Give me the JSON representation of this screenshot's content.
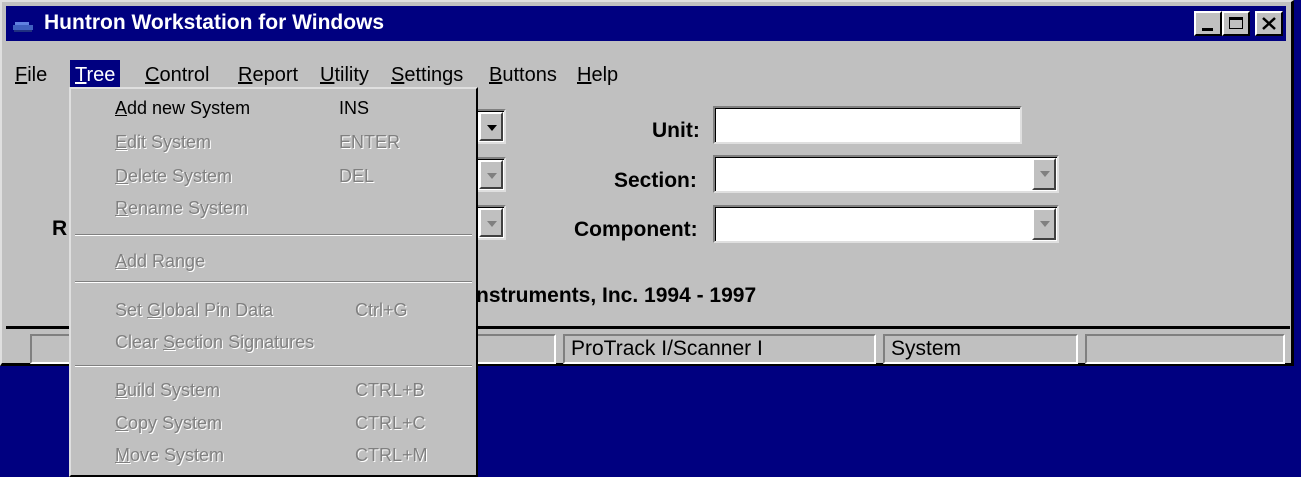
{
  "window": {
    "title": "Huntron Workstation for Windows"
  },
  "menubar": {
    "items": [
      {
        "label": "File",
        "mn": "F",
        "rest": "ile"
      },
      {
        "label": "Tree",
        "mn": "T",
        "rest": "ree"
      },
      {
        "label": "Control",
        "mn": "C",
        "rest": "ontrol"
      },
      {
        "label": "Report",
        "mn": "R",
        "rest": "eport"
      },
      {
        "label": "Utility",
        "mn": "U",
        "rest": "tility"
      },
      {
        "label": "Settings",
        "mn": "S",
        "rest": "ettings"
      },
      {
        "label": "Buttons",
        "mn": "B",
        "rest": "uttons"
      },
      {
        "label": "Help",
        "mn": "H",
        "rest": "elp"
      }
    ]
  },
  "form": {
    "unit_label": "Unit:",
    "unit_value": "",
    "section_label": "Section:",
    "section_value": "",
    "component_label": "Component:",
    "component_value": "",
    "hidden_label_fragment": "R",
    "copyright_fragment": "nstruments, Inc. 1994 - 1997"
  },
  "status_bar": {
    "panels": [
      "",
      "",
      "ProTrack I/Scanner I",
      "System",
      ""
    ]
  },
  "tree_menu": {
    "items": [
      {
        "mn": "A",
        "rest": "dd new System",
        "shortcut": "INS",
        "enabled": true
      },
      {
        "mn": "E",
        "rest": "dit System",
        "shortcut": "ENTER",
        "enabled": false
      },
      {
        "mn": "D",
        "rest": "elete System",
        "shortcut": "DEL",
        "enabled": false
      },
      {
        "mn": "R",
        "rest": "ename System",
        "shortcut": "",
        "enabled": false
      },
      {
        "mn": "A",
        "rest": "dd Range",
        "shortcut": "",
        "enabled": false
      },
      {
        "pre": "Set ",
        "mn": "G",
        "rest": "lobal Pin Data",
        "shortcut": "Ctrl+G",
        "enabled": false
      },
      {
        "pre": "Clear ",
        "mn": "S",
        "rest": "ection Signatures",
        "shortcut": "",
        "enabled": false
      },
      {
        "mn": "B",
        "rest": "uild System",
        "shortcut": "CTRL+B",
        "enabled": false
      },
      {
        "mn": "C",
        "rest": "opy System",
        "shortcut": "CTRL+C",
        "enabled": false
      },
      {
        "mn": "M",
        "rest": "ove System",
        "shortcut": "CTRL+M",
        "enabled": false
      }
    ]
  },
  "colors": {
    "desktop": "#000080",
    "titlebar": "#000080",
    "face": "#c0c0c0"
  }
}
